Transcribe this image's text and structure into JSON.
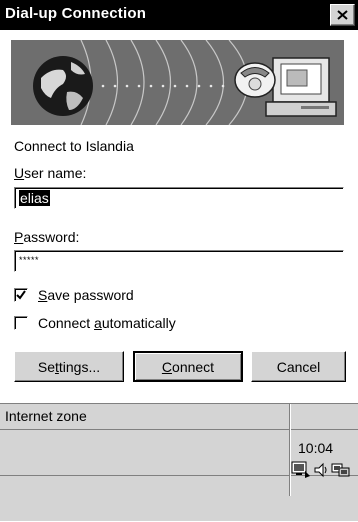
{
  "dialog": {
    "title": "Dial-up Connection",
    "connect_to": "Connect to Islandia",
    "username": {
      "label_pre": "",
      "label_u": "U",
      "label_post": "ser name:",
      "value": "elias"
    },
    "password": {
      "label_u": "P",
      "label_post": "assword:",
      "value": "*****"
    },
    "save_password": {
      "label_u": "S",
      "label_post": "ave password",
      "checked": true
    },
    "connect_auto": {
      "label_pre": "Connect ",
      "label_u": "a",
      "label_post": "utomatically",
      "checked": false
    },
    "buttons": {
      "settings": {
        "pre": "Se",
        "u": "t",
        "post": "tings..."
      },
      "connect": {
        "u": "C",
        "post": "onnect"
      },
      "cancel": "Cancel"
    }
  },
  "statusbar": {
    "zone": "Internet zone",
    "clock": "10:04",
    "tray_icons": [
      "network-monitor-icon",
      "speaker-icon",
      "modem-connection-icon"
    ]
  }
}
